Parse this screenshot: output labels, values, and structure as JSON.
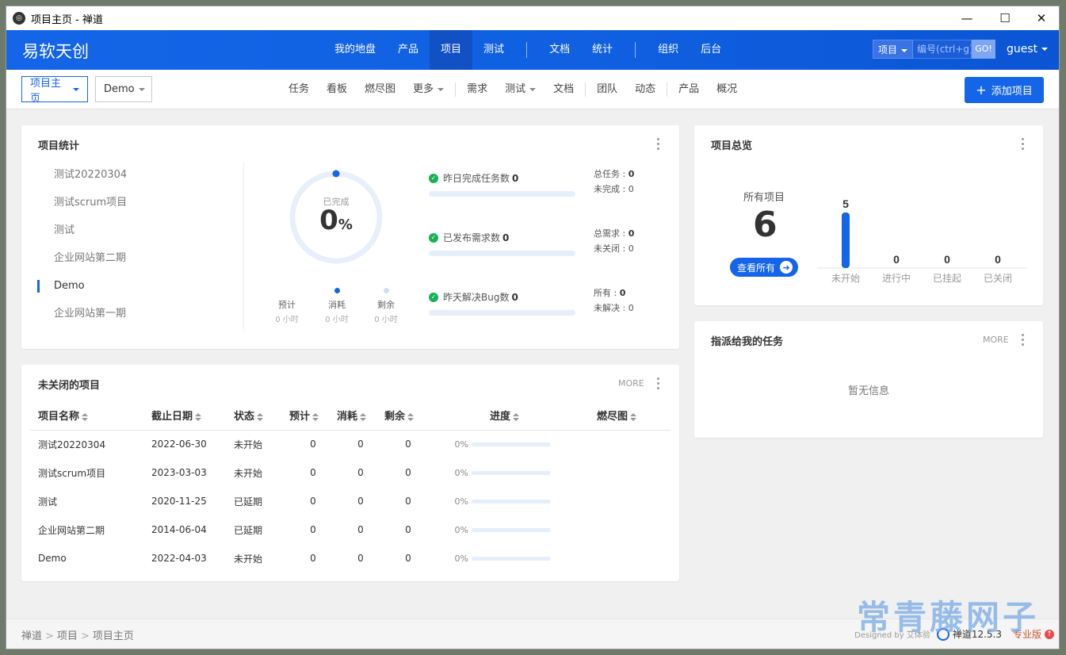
{
  "window": {
    "title": "项目主页 - 禅道",
    "min": "—",
    "max": "☐",
    "close": "✕"
  },
  "topbar": {
    "brand": "易软天创",
    "nav": [
      {
        "label": "我的地盘"
      },
      {
        "label": "产品"
      },
      {
        "label": "项目",
        "active": true
      },
      {
        "label": "测试"
      },
      {
        "label": "文档"
      },
      {
        "label": "统计"
      },
      {
        "label": "组织"
      },
      {
        "label": "后台"
      }
    ],
    "search": {
      "scope": "项目",
      "placeholder": "编号(ctrl+g)",
      "go": "GO!"
    },
    "user": "guest"
  },
  "subbar": {
    "crumb1": "项目主页",
    "crumb2": "Demo",
    "nav": [
      "任务",
      "看板",
      "燃尽图",
      "更多",
      "需求",
      "测试",
      "文档",
      "团队",
      "动态",
      "产品",
      "概况"
    ],
    "add_label": "添加项目"
  },
  "stats": {
    "title": "项目统计",
    "projects": [
      "测试20220304",
      "测试scrum项目",
      "测试",
      "企业网站第二期",
      "Demo",
      "企业网站第一期"
    ],
    "active_project": "Demo",
    "donut": {
      "label": "已完成",
      "value": "0",
      "unit": "%",
      "progress": 0
    },
    "legend": [
      {
        "label": "预计",
        "value": "0",
        "unit": "小时",
        "color": "#ffffff"
      },
      {
        "label": "消耗",
        "value": "0",
        "unit": "小时",
        "color": "#1565e8"
      },
      {
        "label": "剩余",
        "value": "0",
        "unit": "小时",
        "color": "#cfdcf3"
      }
    ],
    "metrics": [
      {
        "label": "昨日完成任务数",
        "value": "0",
        "r1": "总任务",
        "v1": "0",
        "r2": "未完成",
        "v2": "0"
      },
      {
        "label": "已发布需求数",
        "value": "0",
        "r1": "总需求",
        "v1": "0",
        "r2": "未关闭",
        "v2": "0"
      },
      {
        "label": "昨天解决Bug数",
        "value": "0",
        "r1": "所有",
        "v1": "0",
        "r2": "未解决",
        "v2": "0"
      }
    ]
  },
  "overview": {
    "title": "项目总览",
    "all_label": "所有项目",
    "all_value": "6",
    "view_all": "查看所有",
    "bars": [
      {
        "label": "未开始",
        "value": 5
      },
      {
        "label": "进行中",
        "value": 0
      },
      {
        "label": "已挂起",
        "value": 0
      },
      {
        "label": "已关闭",
        "value": 0
      }
    ]
  },
  "assigned": {
    "title": "指派给我的任务",
    "more": "MORE",
    "empty": "暂无信息"
  },
  "open_projects": {
    "title": "未关闭的项目",
    "more": "MORE",
    "headers": [
      "项目名称",
      "截止日期",
      "状态",
      "预计",
      "消耗",
      "剩余",
      "进度",
      "燃尽图"
    ],
    "rows": [
      {
        "name": "测试20220304",
        "date": "2022-06-30",
        "status": "未开始",
        "late": false,
        "est": "0",
        "used": "0",
        "left": "0",
        "progress": "0%"
      },
      {
        "name": "测试scrum项目",
        "date": "2023-03-03",
        "status": "未开始",
        "late": false,
        "est": "0",
        "used": "0",
        "left": "0",
        "progress": "0%"
      },
      {
        "name": "测试",
        "date": "2020-11-25",
        "status": "已延期",
        "late": true,
        "est": "0",
        "used": "0",
        "left": "0",
        "progress": "0%"
      },
      {
        "name": "企业网站第二期",
        "date": "2014-06-04",
        "status": "已延期",
        "late": true,
        "est": "0",
        "used": "0",
        "left": "0",
        "progress": "0%"
      },
      {
        "name": "Demo",
        "date": "2022-04-03",
        "status": "未开始",
        "late": false,
        "est": "0",
        "used": "0",
        "left": "0",
        "progress": "0%"
      }
    ]
  },
  "footer": {
    "crumbs": [
      "禅道",
      "项目",
      "项目主页"
    ],
    "designed": "Designed by 艾体验",
    "version": "禅道12.5.3",
    "edition": "专业版"
  },
  "watermark": "常青藤网子",
  "colors": {
    "primary": "#1565e8",
    "late": "#e03c3c",
    "success": "#18b154"
  }
}
